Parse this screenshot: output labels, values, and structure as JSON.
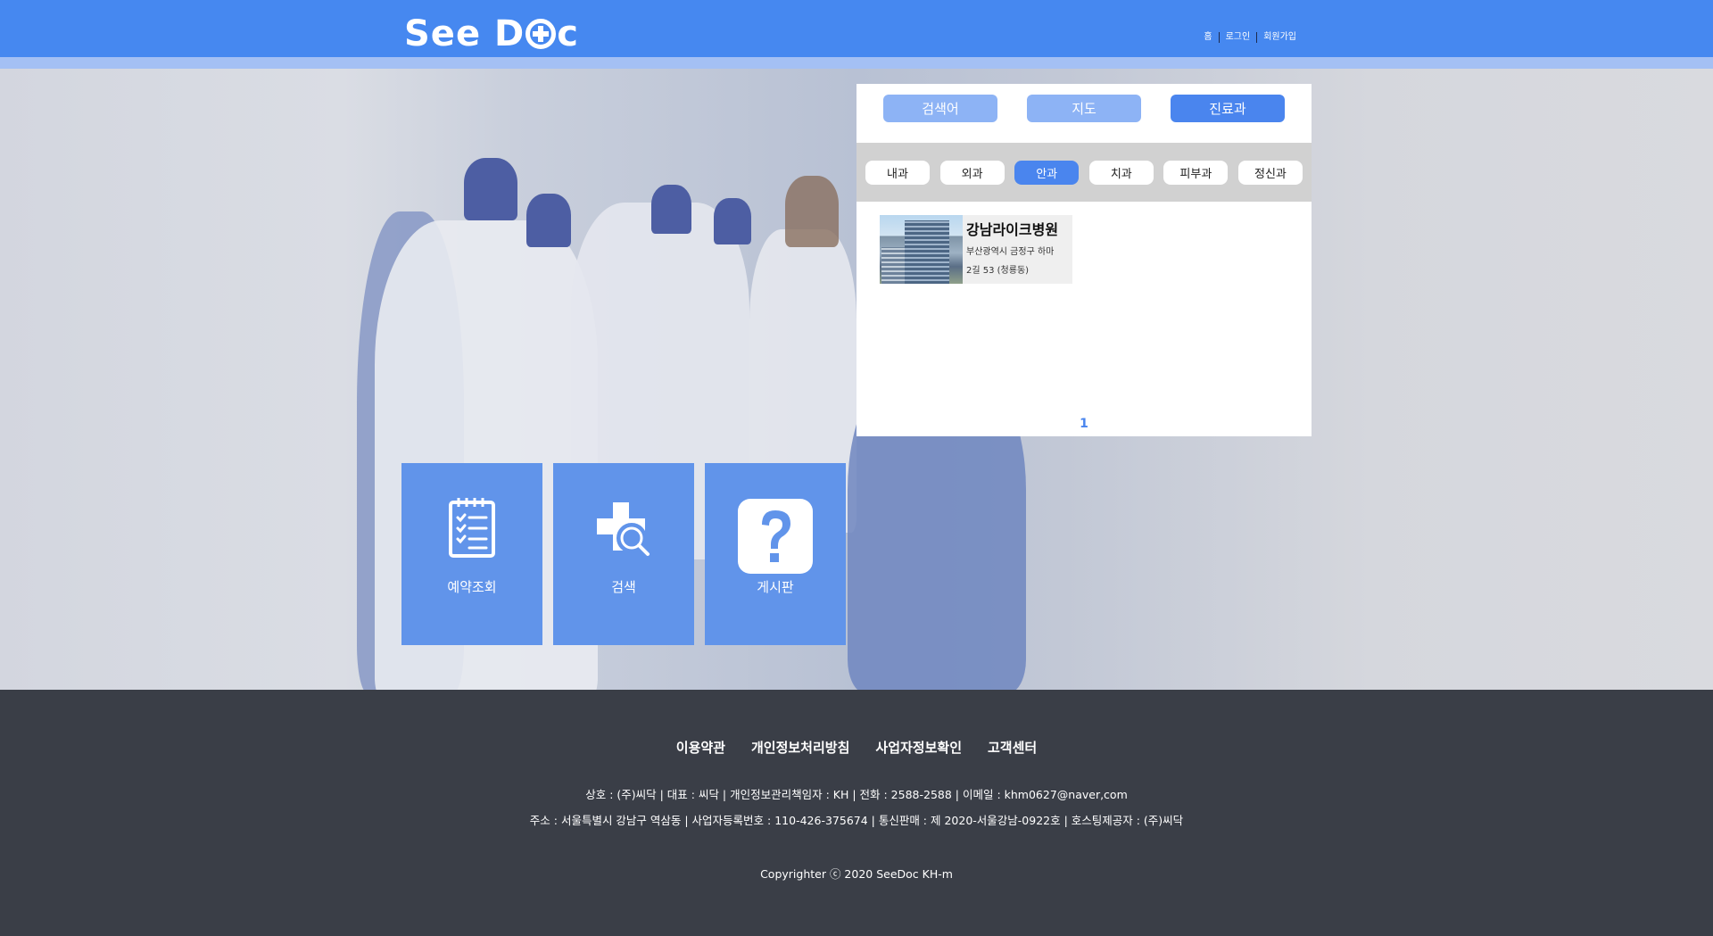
{
  "header": {
    "logo_text_left": "See D",
    "logo_text_right": "c",
    "nav": [
      "홈",
      "로그인",
      "회원가입"
    ]
  },
  "search_panel": {
    "tabs": [
      "검색어",
      "지도",
      "진료과"
    ],
    "active_tab": "진료과",
    "departments": [
      "내과",
      "외과",
      "안과",
      "치과",
      "피부과",
      "정신과"
    ],
    "active_department": "안과",
    "results": [
      {
        "name": "강남라이크병원",
        "address_line1": "부산광역시 금정구 하마",
        "address_line2": "2길 53 (청룡동)"
      }
    ],
    "page": "1"
  },
  "tiles": [
    {
      "label": "예약조회",
      "icon": "checklist-icon"
    },
    {
      "label": "검색",
      "icon": "medical-search-icon"
    },
    {
      "label": "게시판",
      "icon": "question-icon"
    }
  ],
  "footer": {
    "links": [
      "이용약관",
      "개인정보처리방침",
      "사업자정보확인",
      "고객센터"
    ],
    "info_line1": "상호 : (주)씨닥 | 대표 : 씨닥 | 개인정보관리책임자 : KH | 전화 : 2588-2588 | 이메일 : khm0627@naver,com",
    "info_line2": "주소 : 서울특별시 강남구 역삼동 | 사업자등록번호 : 110-426-375674 | 통신판매 : 제 2020-서울강남-0922호 | 호스팅제공자 : (주)씨닥",
    "copyright": "Copyrighter ⓒ 2020 SeeDoc KH-m"
  },
  "colors": {
    "header": "#4688f0",
    "header_strip": "#a4c0f4",
    "accent": "#4a85ee",
    "tab_inactive": "#8db3f5",
    "tile": "#6194ea",
    "footer": "#3a3e47"
  }
}
